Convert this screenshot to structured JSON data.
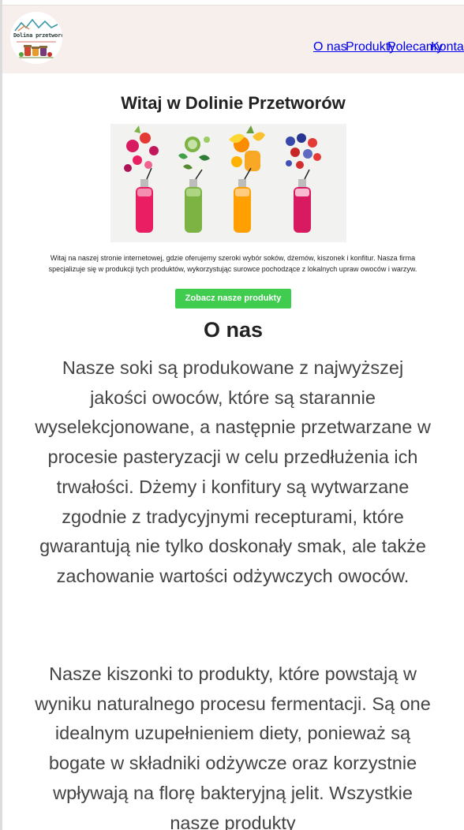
{
  "header": {
    "logo_text": "Dolina przetworów",
    "nav": {
      "o_nas": "O nas",
      "produkty": "Produkty",
      "polecamy": "Polecamy",
      "kontakt": "Kontakt"
    }
  },
  "hero": {
    "title": "Witaj w Dolinie Przetworów",
    "intro": "Witaj na naszej stronie internetowej, gdzie oferujemy szeroki wybór soków, dżemów, kiszonek i konfitur. Nasza firma specjalizuje się w produkcji tych produktów, wykorzystując surowce pochodzące z lokalnych upraw owoców i warzyw.",
    "cta_label": "Zobacz nasze produkty"
  },
  "about": {
    "title": "O nas",
    "paragraph_1": "Nasze soki są produkowane z najwyższej jakości owoców, które są starannie wyselekcjonowane, a następnie przetwarzane w procesie pasteryzacji w celu przedłużenia ich trwałości. Dżemy i konfitury są wytwarzane zgodnie z tradycyjnymi recepturami, które gwarantują nie tylko doskonały smak, ale także zachowanie wartości odżywczych owoców.",
    "paragraph_2": "Nasze kiszonki to produkty, które powstają w wyniku naturalnego procesu fermentacji. Są one idealnym uzupełnieniem diety, ponieważ są bogate w składniki odżywcze oraz korzystnie wpływają na florę bakteryjną jelit. Wszystkie nasze produkty"
  },
  "colors": {
    "header_bg": "#f6efec",
    "nav_link": "#1a1a8c",
    "cta_bg": "#3fcc4f",
    "body_text": "#444444"
  }
}
